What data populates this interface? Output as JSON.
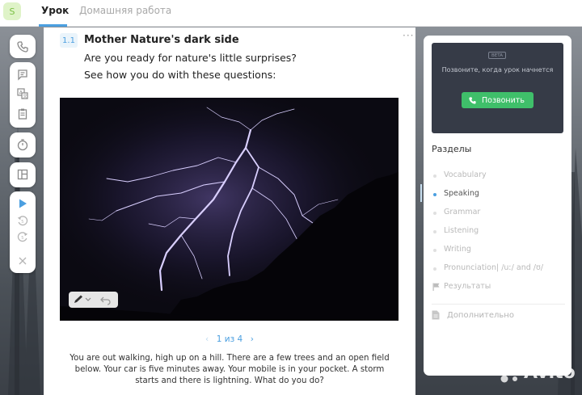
{
  "header": {
    "logo_letter": "S",
    "tabs": [
      {
        "label": "Урок",
        "active": true
      },
      {
        "label": "Домашняя работа",
        "active": false
      }
    ]
  },
  "toolbar": {
    "icons": [
      "phone-icon",
      "chat-icon",
      "translate-icon",
      "clipboard-icon",
      "timer-icon",
      "layout-icon",
      "play-icon",
      "rewind-icon",
      "forward-icon",
      "close-icon"
    ]
  },
  "exercise": {
    "number": "1.1",
    "title": "Mother Nature's dark side",
    "intro_line1": "Are you ready for nature's little surprises?",
    "intro_line2": "See how you do with these questions:",
    "more": "···",
    "pager": {
      "prev": "‹",
      "text": "1 из 4",
      "next": "›"
    },
    "story": "You are out walking, high up on a hill. There are a few trees and an open field below. Your car is five minutes away. Your mobile is in your pocket. A storm starts and there is lightning. What do you do?"
  },
  "sidebar": {
    "video": {
      "beta": "BETA",
      "message": "Позвоните, когда урок начнется",
      "call_button": "Позвонить"
    },
    "sections_title": "Разделы",
    "sections": [
      {
        "label": "Vocabulary",
        "active": false
      },
      {
        "label": "Speaking",
        "active": true
      },
      {
        "label": "Grammar",
        "active": false
      },
      {
        "label": "Listening",
        "active": false
      },
      {
        "label": "Writing",
        "active": false
      },
      {
        "label": "Pronunciation| /uː/ and /ʊ/",
        "active": false
      },
      {
        "label": "Результаты",
        "active": false
      }
    ],
    "extra": "Дополнительно"
  },
  "watermark": "Avito",
  "colors": {
    "accent": "#4b9fe0",
    "call_green": "#3fbf6a",
    "video_bg": "#363b47"
  }
}
